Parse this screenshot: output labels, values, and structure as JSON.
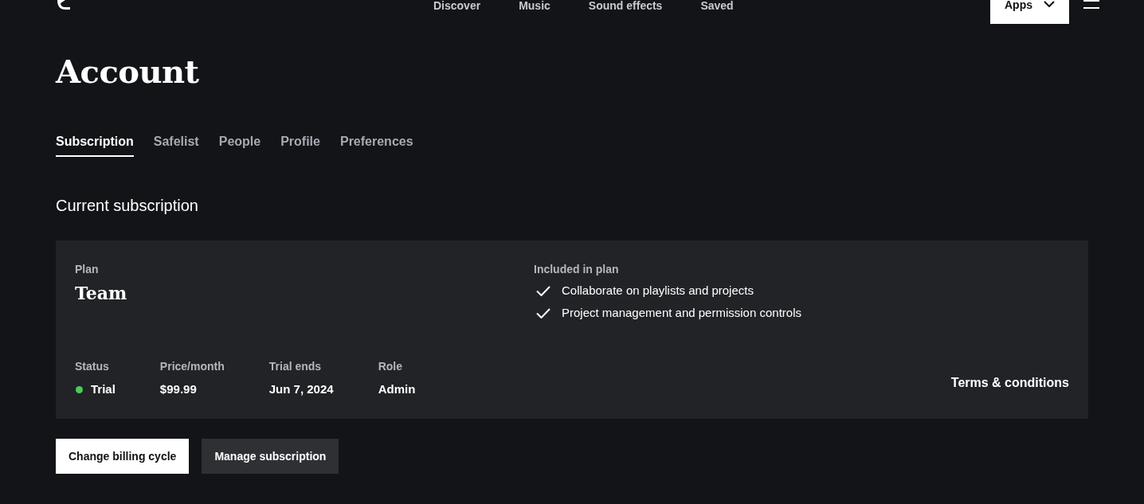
{
  "header": {
    "nav": [
      "Discover",
      "Music",
      "Sound effects",
      "Saved"
    ],
    "apps_button": "Apps"
  },
  "page": {
    "title": "Account"
  },
  "tabs": [
    {
      "label": "Subscription",
      "selected": true
    },
    {
      "label": "Safelist",
      "selected": false
    },
    {
      "label": "People",
      "selected": false
    },
    {
      "label": "Profile",
      "selected": false
    },
    {
      "label": "Preferences",
      "selected": false
    }
  ],
  "section_title": "Current subscription",
  "plan_card": {
    "plan_label": "Plan",
    "plan_name": "Team",
    "included_label": "Included in plan",
    "features": [
      "Collaborate on playlists and projects",
      "Project management and permission controls"
    ],
    "details": [
      {
        "kind": "status",
        "label": "Status",
        "value": "Trial",
        "color": "#4cc95b"
      },
      {
        "kind": "text",
        "label": "Price/month",
        "value": "$99.99"
      },
      {
        "kind": "text",
        "label": "Trial ends",
        "value": "Jun 7, 2024"
      },
      {
        "kind": "text",
        "label": "Role",
        "value": "Admin"
      }
    ],
    "terms_link": "Terms & conditions"
  },
  "buttons": [
    {
      "kind": "primary",
      "label": "Change billing cycle"
    },
    {
      "kind": "secondary",
      "label": "Manage subscription"
    }
  ]
}
